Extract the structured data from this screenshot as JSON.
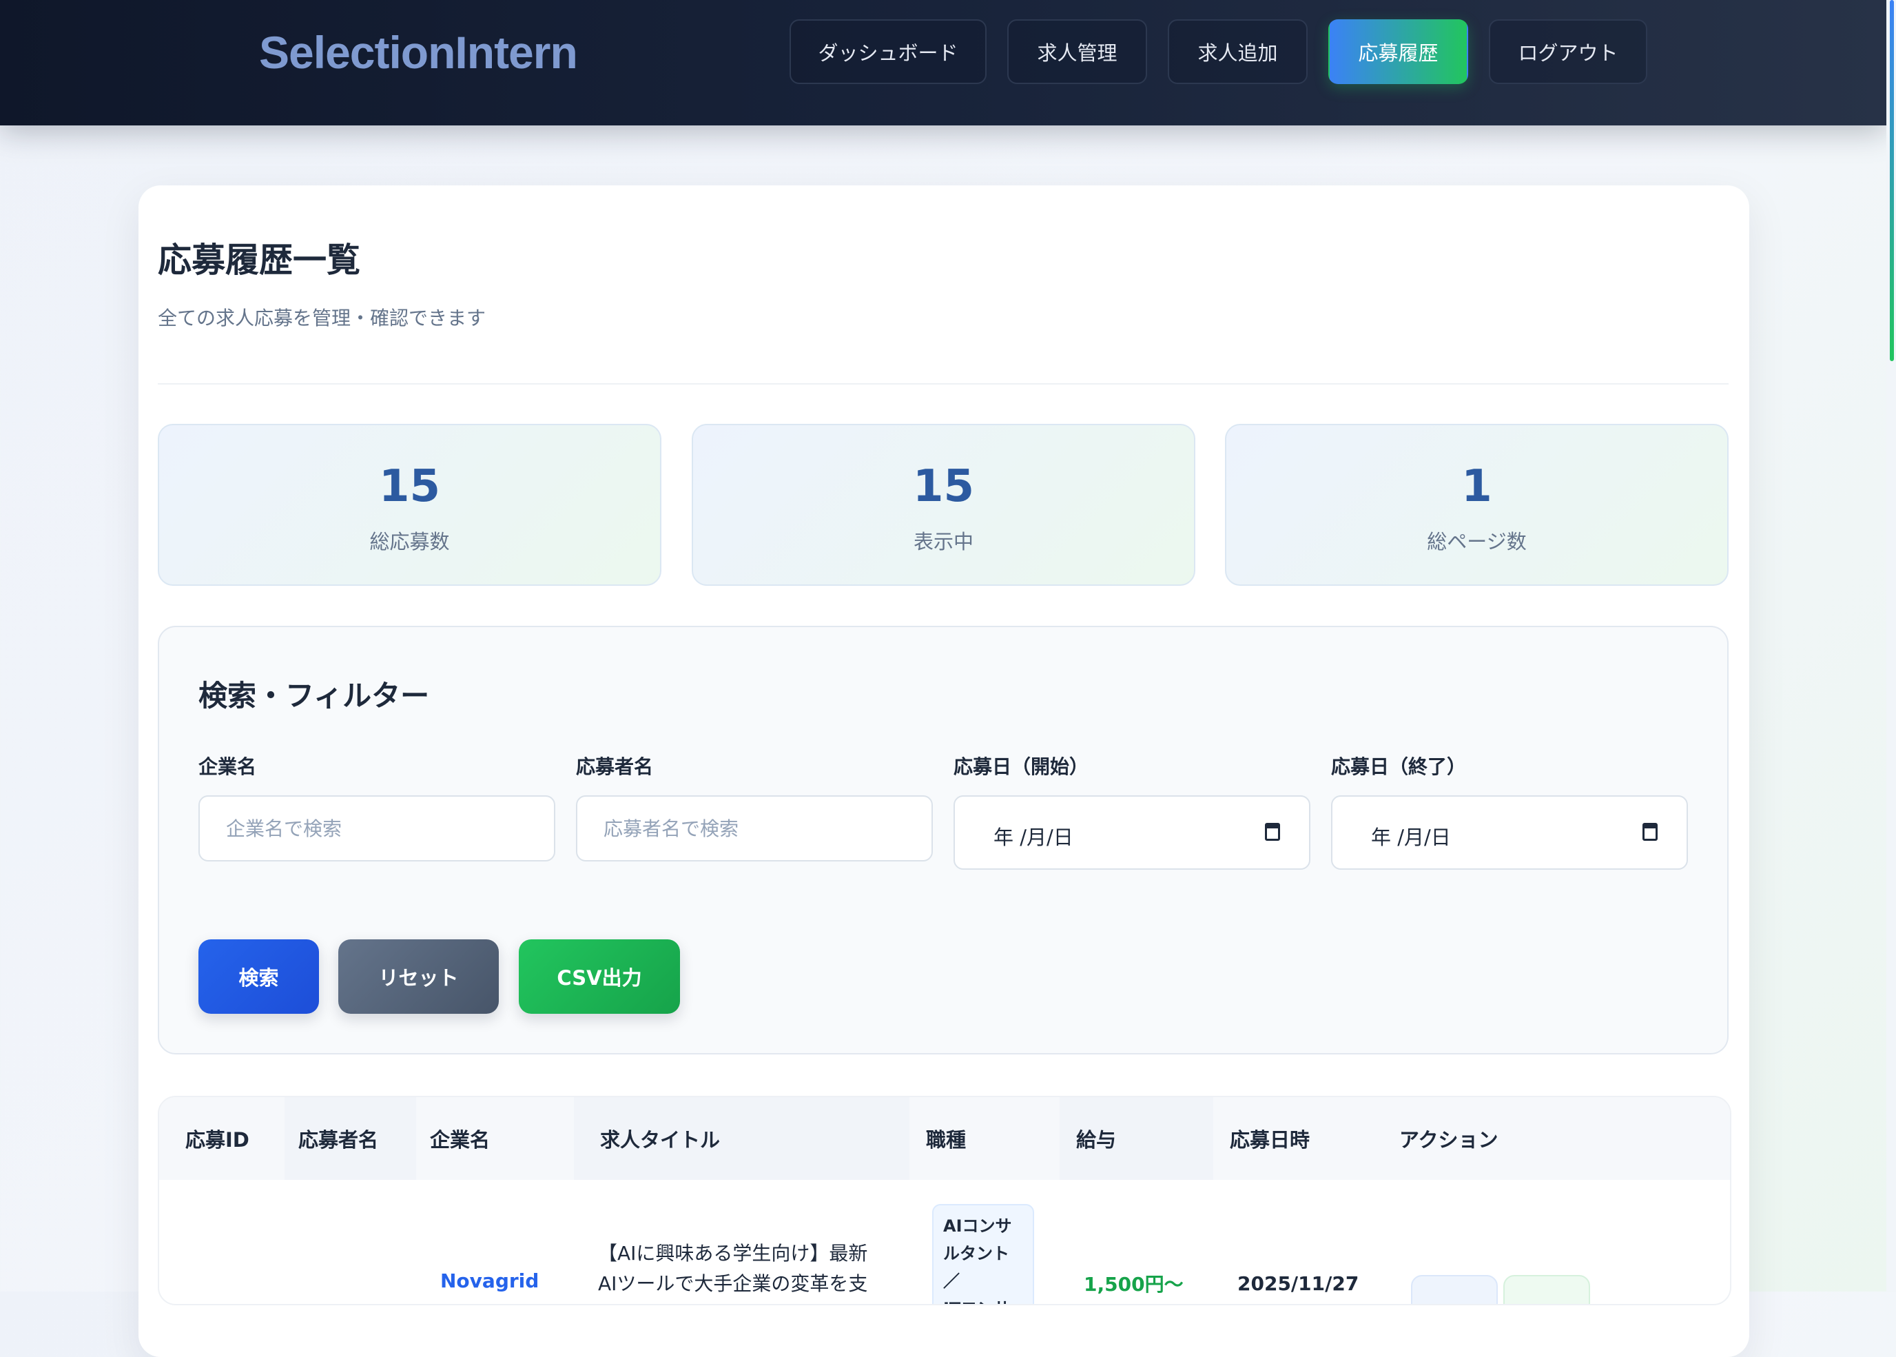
{
  "header": {
    "logo": "SelectionIntern",
    "nav": [
      {
        "label": "ダッシュボード",
        "active": false
      },
      {
        "label": "求人管理",
        "active": false
      },
      {
        "label": "求人追加",
        "active": false
      },
      {
        "label": "応募履歴",
        "active": true
      },
      {
        "label": "ログアウト",
        "active": false
      }
    ]
  },
  "page": {
    "title": "応募履歴一覧",
    "subtitle": "全ての求人応募を管理・確認できます"
  },
  "stats": [
    {
      "value": "15",
      "label": "総応募数"
    },
    {
      "value": "15",
      "label": "表示中"
    },
    {
      "value": "1",
      "label": "総ページ数"
    }
  ],
  "filter": {
    "title": "検索・フィルター",
    "company": {
      "label": "企業名",
      "placeholder": "企業名で検索",
      "value": ""
    },
    "applicant": {
      "label": "応募者名",
      "placeholder": "応募者名で検索",
      "value": ""
    },
    "date_start": {
      "label": "応募日（開始）",
      "value": "年 /月/日"
    },
    "date_end": {
      "label": "応募日（終了）",
      "value": "年 /月/日"
    },
    "buttons": {
      "search": "検索",
      "reset": "リセット",
      "csv": "CSV出力"
    }
  },
  "table": {
    "columns": [
      "応募ID",
      "応募者名",
      "企業名",
      "求人タイトル",
      "職種",
      "給与",
      "応募日時",
      "アクション"
    ],
    "rows": [
      {
        "company": "Novagrid",
        "title_line1": "【AIに興味ある学生向け】最新",
        "title_line2": "AIツールで大手企業の変革を支",
        "job_type_line1": "AIコンサ",
        "job_type_line2": "ルタント／",
        "job_type_line3": "ITコンサル",
        "salary": "1,500円〜",
        "date": "2025/11/27"
      }
    ]
  },
  "colors": {
    "accent_blue": "#2563eb",
    "accent_green": "#22c55e",
    "header_bg": "#0f172a",
    "stat_value": "#2c5aa0"
  }
}
